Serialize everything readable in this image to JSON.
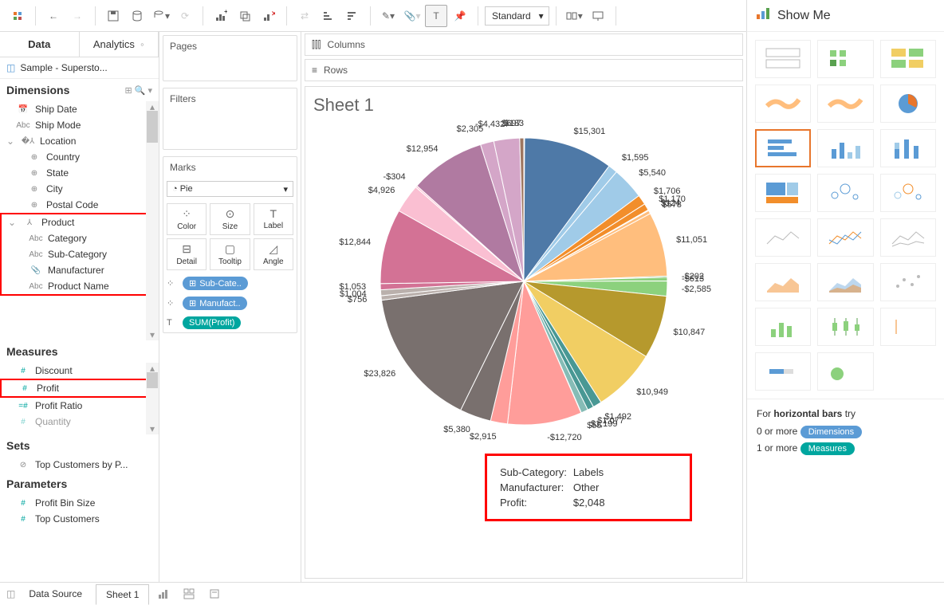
{
  "toolbar": {
    "style_select": "Standard",
    "showme": "Show Me"
  },
  "left": {
    "tabs": {
      "data": "Data",
      "analytics": "Analytics"
    },
    "datasource": "Sample - Supersto...",
    "dimensions_hdr": "Dimensions",
    "measures_hdr": "Measures",
    "sets_hdr": "Sets",
    "parameters_hdr": "Parameters",
    "fields": {
      "ship_date": "Ship Date",
      "ship_mode": "Ship Mode",
      "location": "Location",
      "country": "Country",
      "state": "State",
      "city": "City",
      "postal": "Postal Code",
      "product": "Product",
      "category": "Category",
      "sub_category": "Sub-Category",
      "manufacturer": "Manufacturer",
      "product_name": "Product Name",
      "discount": "Discount",
      "profit": "Profit",
      "profit_ratio": "Profit Ratio",
      "quantity": "Quantity",
      "top_customers": "Top Customers by P...",
      "profit_bin": "Profit Bin Size",
      "top_cust_param": "Top Customers"
    }
  },
  "mid": {
    "pages": "Pages",
    "filters": "Filters",
    "marks": "Marks",
    "mark_type": "Pie",
    "cells": {
      "color": "Color",
      "size": "Size",
      "label": "Label",
      "detail": "Detail",
      "tooltip": "Tooltip",
      "angle": "Angle"
    },
    "pills": {
      "p1": "Sub-Cate..",
      "p2": "Manufact..",
      "p3": "SUM(Profit)"
    }
  },
  "canvas": {
    "columns": "Columns",
    "rows": "Rows",
    "sheet_title": "Sheet 1",
    "labels": [
      "$2,305",
      "-$4,432",
      "$697",
      "$133",
      "$15,301",
      "$1,595",
      "$5,540",
      "$1,706",
      "$1,170",
      "$124",
      "$578",
      "$11,051",
      "-$202",
      "-$613",
      "-$2,585",
      "$10,847",
      "$10,949",
      "$1,492",
      "$1,077",
      "$1,199",
      "$55",
      "-$12,720",
      "$2,915",
      "$5,380",
      "$23,826",
      "$756",
      "$1,004",
      "$1,053",
      "$12,844",
      "$4,926",
      "-$304",
      "$12,954"
    ],
    "tooltip": {
      "k1": "Sub-Category:",
      "v1": "Labels",
      "k2": "Manufacturer:",
      "v2": "Other",
      "k3": "Profit:",
      "v3": "$2,048"
    }
  },
  "right": {
    "hint_pre": "For ",
    "hint_bold": "horizontal bars",
    "hint_post": " try",
    "line1_pre": "0 or more ",
    "line1_tag": "Dimensions",
    "line2_pre": "1 or more ",
    "line2_tag": "Measures"
  },
  "bottom": {
    "data_source": "Data Source",
    "sheet1": "Sheet 1"
  },
  "chart_data": {
    "type": "pie",
    "title": "Sheet 1",
    "series": [
      {
        "label": "$133",
        "value": 133,
        "color": "#4e79a7"
      },
      {
        "label": "$15,301",
        "value": 15301,
        "color": "#4e79a7"
      },
      {
        "label": "$1,595",
        "value": 1595,
        "color": "#a0cbe8"
      },
      {
        "label": "$5,540",
        "value": 5540,
        "color": "#a0cbe8"
      },
      {
        "label": "$1,706",
        "value": 1706,
        "color": "#f28e2b"
      },
      {
        "label": "$1,170",
        "value": 1170,
        "color": "#f28e2b"
      },
      {
        "label": "$124",
        "value": 124,
        "color": "#ffbe7d"
      },
      {
        "label": "$578",
        "value": 578,
        "color": "#ffbe7d"
      },
      {
        "label": "$11,051",
        "value": 11051,
        "color": "#ffbe7d"
      },
      {
        "label": "-$202",
        "value": 202,
        "color": "#59a14f"
      },
      {
        "label": "-$613",
        "value": 613,
        "color": "#8cd17d"
      },
      {
        "label": "-$2,585",
        "value": 2585,
        "color": "#8cd17d"
      },
      {
        "label": "$10,847",
        "value": 10847,
        "color": "#b6992d"
      },
      {
        "label": "$10,949",
        "value": 10949,
        "color": "#f1ce63"
      },
      {
        "label": "$1,492",
        "value": 1492,
        "color": "#499894"
      },
      {
        "label": "$1,077",
        "value": 1077,
        "color": "#499894"
      },
      {
        "label": "$1,199",
        "value": 1199,
        "color": "#86bcb6"
      },
      {
        "label": "$55",
        "value": 55,
        "color": "#e15759"
      },
      {
        "label": "-$12,720",
        "value": 12720,
        "color": "#ff9d9a"
      },
      {
        "label": "$2,915",
        "value": 2915,
        "color": "#ff9d9a"
      },
      {
        "label": "$5,380",
        "value": 5380,
        "color": "#79706e"
      },
      {
        "label": "$23,826",
        "value": 23826,
        "color": "#79706e"
      },
      {
        "label": "$756",
        "value": 756,
        "color": "#bab0ac"
      },
      {
        "label": "$1,004",
        "value": 1004,
        "color": "#bab0ac"
      },
      {
        "label": "$1,053",
        "value": 1053,
        "color": "#d37295"
      },
      {
        "label": "$12,844",
        "value": 12844,
        "color": "#d37295"
      },
      {
        "label": "$4,926",
        "value": 4926,
        "color": "#fabfd2"
      },
      {
        "label": "-$304",
        "value": 304,
        "color": "#fabfd2"
      },
      {
        "label": "$12,954",
        "value": 12954,
        "color": "#b07aa1"
      },
      {
        "label": "$2,305",
        "value": 2305,
        "color": "#d4a6c8"
      },
      {
        "label": "-$4,432",
        "value": 4432,
        "color": "#d4a6c8"
      },
      {
        "label": "$697",
        "value": 697,
        "color": "#9d7660"
      }
    ]
  }
}
